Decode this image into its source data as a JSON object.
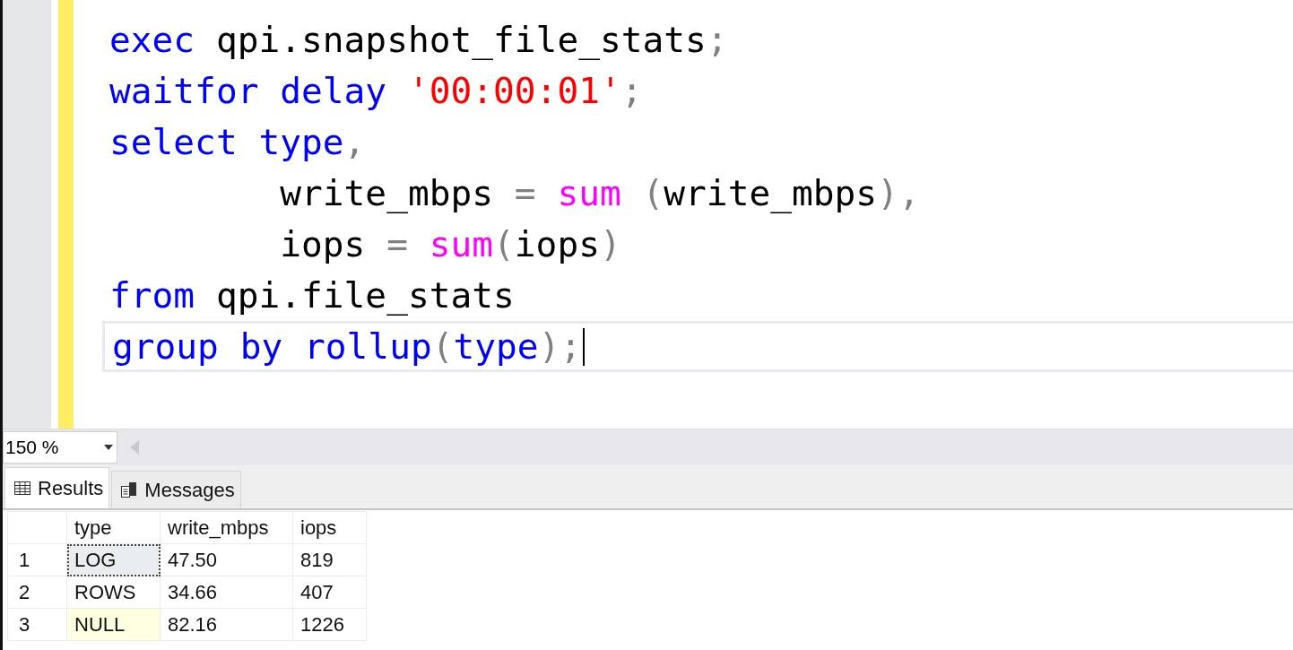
{
  "editor": {
    "lines": [
      {
        "current": false,
        "tokens": [
          {
            "kind": "keyword",
            "text": "exec"
          },
          {
            "kind": "ident",
            "text": " qpi.snapshot_file_stats"
          },
          {
            "kind": "op",
            "text": ";"
          }
        ]
      },
      {
        "current": false,
        "tokens": [
          {
            "kind": "keyword",
            "text": "waitfor delay "
          },
          {
            "kind": "string",
            "text": "'00:00:01'"
          },
          {
            "kind": "op",
            "text": ";"
          }
        ]
      },
      {
        "current": false,
        "tokens": [
          {
            "kind": "keyword",
            "text": "select type"
          },
          {
            "kind": "op",
            "text": ","
          }
        ]
      },
      {
        "current": false,
        "tokens": [
          {
            "kind": "ident",
            "text": "        write_mbps "
          },
          {
            "kind": "op",
            "text": "= "
          },
          {
            "kind": "function",
            "text": "sum"
          },
          {
            "kind": "op",
            "text": " ("
          },
          {
            "kind": "ident",
            "text": "write_mbps"
          },
          {
            "kind": "op",
            "text": "),"
          }
        ]
      },
      {
        "current": false,
        "tokens": [
          {
            "kind": "ident",
            "text": "        iops "
          },
          {
            "kind": "op",
            "text": "= "
          },
          {
            "kind": "function",
            "text": "sum"
          },
          {
            "kind": "op",
            "text": "("
          },
          {
            "kind": "ident",
            "text": "iops"
          },
          {
            "kind": "op",
            "text": ")"
          }
        ]
      },
      {
        "current": false,
        "tokens": [
          {
            "kind": "keyword",
            "text": "from"
          },
          {
            "kind": "ident",
            "text": " qpi.file_stats"
          }
        ]
      },
      {
        "current": true,
        "tokens": [
          {
            "kind": "keyword",
            "text": "group by rollup"
          },
          {
            "kind": "op",
            "text": "("
          },
          {
            "kind": "keyword",
            "text": "type"
          },
          {
            "kind": "op",
            "text": ");"
          }
        ]
      }
    ]
  },
  "zoom": {
    "value": "150 %"
  },
  "tabs": [
    {
      "label": "Results",
      "kind": "grid",
      "selected": true
    },
    {
      "label": "Messages",
      "kind": "messages",
      "selected": false
    }
  ],
  "table": {
    "columns": [
      "type",
      "write_mbps",
      "iops"
    ],
    "rows": [
      {
        "number": "1",
        "cells": [
          {
            "text": "LOG",
            "focused": true,
            "null": false
          },
          {
            "text": "47.50",
            "focused": false,
            "null": false
          },
          {
            "text": "819",
            "focused": false,
            "null": false
          }
        ]
      },
      {
        "number": "2",
        "cells": [
          {
            "text": "ROWS",
            "focused": false,
            "null": false
          },
          {
            "text": "34.66",
            "focused": false,
            "null": false
          },
          {
            "text": "407",
            "focused": false,
            "null": false
          }
        ]
      },
      {
        "number": "3",
        "cells": [
          {
            "text": "NULL",
            "focused": false,
            "null": true
          },
          {
            "text": "82.16",
            "focused": false,
            "null": false
          },
          {
            "text": "1226",
            "focused": false,
            "null": false
          }
        ]
      }
    ]
  }
}
